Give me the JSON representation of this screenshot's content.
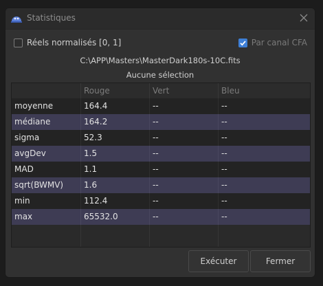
{
  "window": {
    "title": "Statistiques"
  },
  "options": {
    "normalized_label": "Réels normalisés [0, 1]",
    "normalized_checked": false,
    "cfa_label": "Par canal CFA",
    "cfa_checked": true
  },
  "file_path": "C:\\APP\\Masters\\MasterDark180s-10C.fits",
  "selection_text": "Aucune sélection",
  "table": {
    "headers": [
      "",
      "Rouge",
      "Vert",
      "Bleu"
    ],
    "rows": [
      [
        "moyenne",
        "164.4",
        "--",
        "--"
      ],
      [
        "médiane",
        "164.2",
        "--",
        "--"
      ],
      [
        "sigma",
        "52.3",
        "--",
        "--"
      ],
      [
        "avgDev",
        "1.5",
        "--",
        "--"
      ],
      [
        "MAD",
        "1.1",
        "--",
        "--"
      ],
      [
        "sqrt(BWMV)",
        "1.6",
        "--",
        "--"
      ],
      [
        "min",
        "112.4",
        "--",
        "--"
      ],
      [
        "max",
        "65532.0",
        "--",
        "--"
      ]
    ]
  },
  "buttons": {
    "execute": "Exécuter",
    "close": "Fermer"
  },
  "icons": {
    "app": "siril-app-icon",
    "close": "close-icon",
    "check": "checkmark-icon"
  },
  "colors": {
    "accent": "#3e7fd6",
    "row_highlight": "#3e3c54",
    "row_dark": "#232323",
    "window_bg": "#313131"
  }
}
